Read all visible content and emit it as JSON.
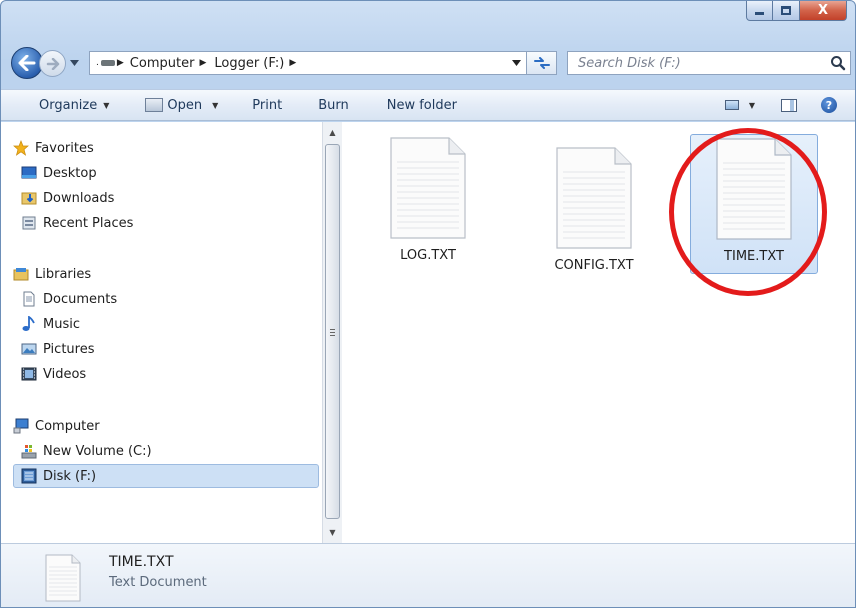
{
  "window": {
    "close_glyph": "X"
  },
  "address": {
    "breadcrumbs": [
      "Computer",
      "Logger (F:)"
    ],
    "icon": "drive-icon"
  },
  "search": {
    "placeholder": "Search Disk (F:)"
  },
  "toolbar": {
    "organize": "Organize",
    "open": "Open",
    "print": "Print",
    "burn": "Burn",
    "new_folder": "New folder"
  },
  "navigation": {
    "favorites": {
      "label": "Favorites",
      "items": [
        "Desktop",
        "Downloads",
        "Recent Places"
      ]
    },
    "libraries": {
      "label": "Libraries",
      "items": [
        "Documents",
        "Music",
        "Pictures",
        "Videos"
      ]
    },
    "computer": {
      "label": "Computer",
      "items": [
        "New Volume (C:)",
        "Disk (F:)"
      ]
    }
  },
  "files": [
    {
      "name": "LOG.TXT",
      "selected": false
    },
    {
      "name": "CONFIG.TXT",
      "selected": false
    },
    {
      "name": "TIME.TXT",
      "selected": true
    }
  ],
  "details": {
    "name": "TIME.TXT",
    "type": "Text Document"
  },
  "colors": {
    "highlight_circle": "#e31b1b",
    "selection": "#cde0f5"
  }
}
